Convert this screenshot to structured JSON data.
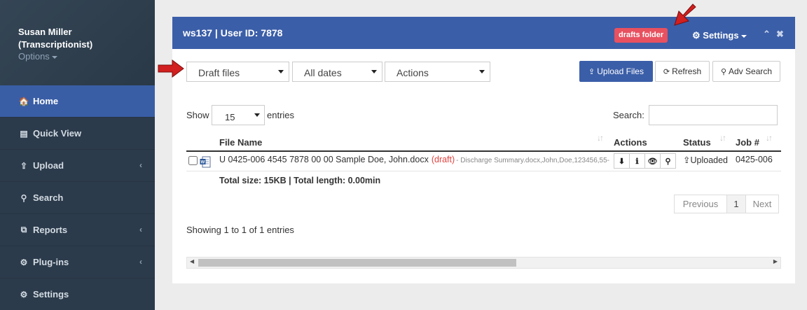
{
  "sidebar": {
    "user_name": "Susan Miller",
    "user_role": "(Transcriptionist)",
    "options_label": "Options",
    "items": [
      {
        "label": "Home",
        "icon": "home-icon",
        "glyph": "🏠"
      },
      {
        "label": "Quick View",
        "icon": "file-icon",
        "glyph": "▤"
      },
      {
        "label": "Upload",
        "icon": "upload-icon",
        "glyph": "⇪"
      },
      {
        "label": "Search",
        "icon": "search-icon",
        "glyph": "⚲"
      },
      {
        "label": "Reports",
        "icon": "reports-icon",
        "glyph": "⧉"
      },
      {
        "label": "Plug-ins",
        "icon": "cogs-icon",
        "glyph": "⚙"
      },
      {
        "label": "Settings",
        "icon": "gear-icon",
        "glyph": "⚙"
      }
    ],
    "chevron": "‹",
    "colors": {
      "background": "#2c3b4b",
      "active": "#3a5ea6"
    }
  },
  "panel": {
    "title": "ws137 | User ID: 7878",
    "badge": "drafts folder",
    "settings_label": "Settings",
    "settings_glyph": "⚙",
    "collapse_glyph": "⌃",
    "close_glyph": "✖",
    "colors": {
      "header": "#3b5ea8",
      "badge": "#e8515f"
    }
  },
  "filters": {
    "folder": "Draft files",
    "dates": "All dates",
    "actions": "Actions"
  },
  "toolbar": {
    "upload_label": "Upload Files",
    "upload_glyph": "⇪",
    "refresh_label": "Refresh",
    "refresh_glyph": "⟳",
    "adv_search_label": "Adv Search",
    "adv_search_glyph": "⚲"
  },
  "table_controls": {
    "show_label": "Show",
    "entries_value": "15",
    "entries_label": "entries",
    "search_label": "Search:"
  },
  "table": {
    "headers": {
      "file_name": "File Name",
      "actions": "Actions",
      "status": "Status",
      "job": "Job #"
    },
    "sort_glyph": "↓↑",
    "rows": [
      {
        "file_name": "U 0425-006 4545 7878 00 00 Sample Doe, John.docx",
        "draft_tag": "(draft)",
        "description": "- Discharge Summary.docx,John,Doe,123456,55-",
        "action_glyphs": [
          "⬇",
          "ℹ",
          "👁",
          "⚲"
        ],
        "status": "Uploaded",
        "status_glyph": "⇪",
        "job": "0425-006"
      }
    ],
    "total": "Total size: 15KB | Total length: 0.00min"
  },
  "pagination": {
    "previous": "Previous",
    "current": "1",
    "next": "Next"
  },
  "info": "Showing 1 to 1 of 1 entries",
  "scrollbar": {
    "left_glyph": "◀",
    "right_glyph": "▶"
  }
}
